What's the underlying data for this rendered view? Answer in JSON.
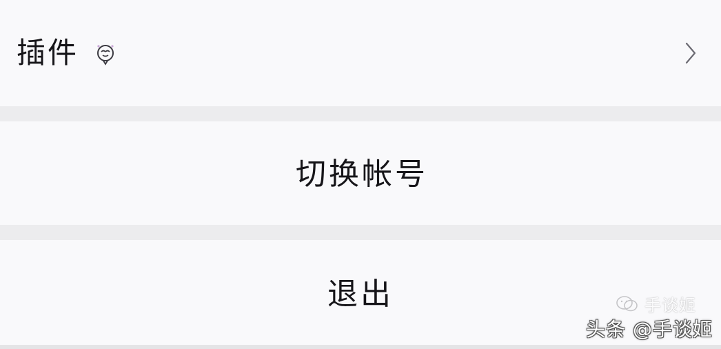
{
  "settings": {
    "plugins": {
      "label": "插件",
      "badge_icon": "plugin-hot-air-balloon-icon",
      "arrow_icon": "chevron-right-icon"
    },
    "switch_account": {
      "label": "切换帐号"
    },
    "logout": {
      "label": "退出"
    }
  },
  "watermark": {
    "brand_text": "手谈姬",
    "credit_text": "头条 @手谈姬"
  },
  "colors": {
    "row_background": "#f9f9fb",
    "separator": "#ececee",
    "text": "#161519",
    "icon_accent": "#c9a6d6",
    "chevron": "#6b6a72"
  }
}
